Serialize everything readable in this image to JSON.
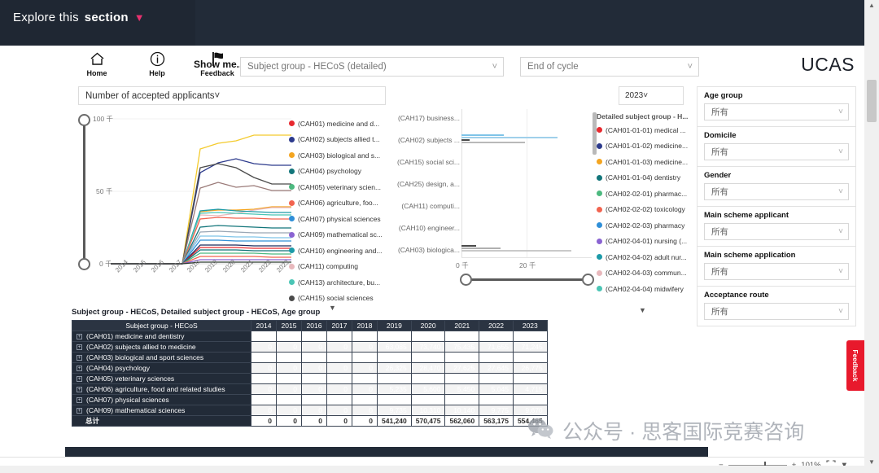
{
  "banner": {
    "explore_prefix": "Explore this",
    "explore_bold": "section",
    "chevron": "chevron-down"
  },
  "toolbar": {
    "items": [
      {
        "label": "Home",
        "icon": "home-icon"
      },
      {
        "label": "Help",
        "icon": "info-icon"
      },
      {
        "label": "Feedback",
        "icon": "flag-icon"
      }
    ],
    "show_me_label": "Show me...",
    "show_me_value": "Subject group - HECoS (detailed)",
    "cycle_value": "End of cycle",
    "brand": "UCAS"
  },
  "chart": {
    "measure_value": "Number of accepted applicants",
    "year_value": "2023",
    "y_ticks": [
      "100 千",
      "50 千",
      "0 千"
    ],
    "x_ticks": [
      "2014",
      "2015",
      "2016",
      "2017",
      "2018",
      "2019",
      "2020",
      "2021",
      "2022",
      "2023"
    ],
    "bar_axis_ticks": [
      "0 千",
      "20 千"
    ],
    "legend_left_title": "",
    "legend_right_title": "Detailed subject group - H...",
    "legend_left": [
      {
        "label": "(CAH01) medicine and d...",
        "color": "#e8292f"
      },
      {
        "label": "(CAH02) subjects allied t...",
        "color": "#2c3a8c"
      },
      {
        "label": "(CAH03) biological and s...",
        "color": "#f4a520"
      },
      {
        "label": "(CAH04) psychology",
        "color": "#12757a"
      },
      {
        "label": "(CAH05) veterinary scien...",
        "color": "#4cb97f"
      },
      {
        "label": "(CAH06) agriculture, foo...",
        "color": "#f2634f"
      },
      {
        "label": "(CAH07) physical sciences",
        "color": "#2f8fd8"
      },
      {
        "label": "(CAH09) mathematical sc...",
        "color": "#8a63d2"
      },
      {
        "label": "(CAH10) engineering and...",
        "color": "#1c9aa8"
      },
      {
        "label": "(CAH11) computing",
        "color": "#e8b8bc"
      },
      {
        "label": "(CAH13) architecture, bu...",
        "color": "#4bc5b5"
      },
      {
        "label": "(CAH15) social sciences",
        "color": "#4a4a4a"
      }
    ],
    "legend_right": [
      {
        "label": "(CAH01-01-01) medical ...",
        "color": "#e8292f"
      },
      {
        "label": "(CAH01-01-02) medicine...",
        "color": "#2c3a8c"
      },
      {
        "label": "(CAH01-01-03) medicine...",
        "color": "#f4a520"
      },
      {
        "label": "(CAH01-01-04) dentistry",
        "color": "#12757a"
      },
      {
        "label": "(CAH02-02-01) pharmac...",
        "color": "#4cb97f"
      },
      {
        "label": "(CAH02-02-02) toxicology",
        "color": "#f2634f"
      },
      {
        "label": "(CAH02-02-03) pharmacy",
        "color": "#2f8fd8"
      },
      {
        "label": "(CAH02-04-01) nursing (...",
        "color": "#8a63d2"
      },
      {
        "label": "(CAH02-04-02) adult nur...",
        "color": "#1c9aa8"
      },
      {
        "label": "(CAH02-04-03) commun...",
        "color": "#e8b8bc"
      },
      {
        "label": "(CAH02-04-04) midwifery",
        "color": "#4bc5b5"
      }
    ],
    "bar_categories": [
      "(CAH17) business...",
      "(CAH02) subjects ...",
      "(CAH15) social sci...",
      "(CAH25) design, a...",
      "(CAH11) computi...",
      "(CAH10) engineer...",
      "(CAH03) biologica..."
    ]
  },
  "chart_data": {
    "type": "line",
    "title": "Number of accepted applicants",
    "xlabel": "",
    "ylabel": "",
    "x": [
      2014,
      2015,
      2016,
      2017,
      2018,
      2019,
      2020,
      2021,
      2022,
      2023
    ],
    "ylim": [
      0,
      100000
    ],
    "y_tick_values": [
      0,
      50000,
      100000
    ],
    "y_tick_labels": [
      "0 千",
      "50 千",
      "100 千"
    ],
    "grid": true,
    "legend_position": "right",
    "series": [
      {
        "name": "(CAH17) business and management",
        "color": "#f4cb2e",
        "values": [
          0,
          0,
          0,
          0,
          0,
          79000,
          83000,
          85000,
          89000,
          89000
        ]
      },
      {
        "name": "(CAH02) subjects allied to medicine",
        "color": "#2c3a8c",
        "values": [
          0,
          0,
          0,
          0,
          0,
          63085,
          73740,
          75435,
          71655,
          71245
        ]
      },
      {
        "name": "(CAH15) social sciences",
        "color": "#4a4a4a",
        "values": [
          0,
          0,
          0,
          0,
          0,
          67000,
          69500,
          67000,
          62000,
          58500
        ]
      },
      {
        "name": "(CAH25) design and creative arts",
        "color": "#9a7a78",
        "values": [
          0,
          0,
          0,
          0,
          0,
          52500,
          56500,
          53000,
          54500,
          50500
        ]
      },
      {
        "name": "(CAH03) biological and sport sciences",
        "color": "#f4a520",
        "values": [
          0,
          0,
          0,
          0,
          0,
          33350,
          34345,
          34455,
          33615,
          32155
        ]
      },
      {
        "name": "(CAH11) computing",
        "color": "#e8b8bc",
        "values": [
          0,
          0,
          0,
          0,
          0,
          31000,
          30500,
          32000,
          33500,
          34500
        ]
      },
      {
        "name": "(CAH10) engineering and technology",
        "color": "#1c9aa8",
        "values": [
          0,
          0,
          0,
          0,
          0,
          32500,
          33500,
          32500,
          32000,
          31500
        ]
      },
      {
        "name": "(CAH13) architecture, building and planning",
        "color": "#4bc5b5",
        "values": [
          0,
          0,
          0,
          0,
          0,
          30500,
          31000,
          30500,
          30000,
          29500
        ]
      },
      {
        "name": "(CAH04) psychology",
        "color": "#12757a",
        "values": [
          0,
          0,
          0,
          0,
          0,
          26325,
          28470,
          27625,
          27645,
          26775
        ]
      },
      {
        "name": "(CAH06) agriculture, food and related studies",
        "color": "#f2634f",
        "values": [
          0,
          0,
          0,
          0,
          0,
          27000,
          28000,
          27500,
          27500,
          27000
        ]
      },
      {
        "name": "(CAH07) physical sciences",
        "color": "#2f8fd8",
        "values": [
          0,
          0,
          0,
          0,
          0,
          15285,
          15400,
          14830,
          14755,
          14560
        ]
      },
      {
        "name": "(CAH09) mathematical sciences",
        "color": "#8a63d2",
        "values": [
          0,
          0,
          0,
          0,
          0,
          9735,
          10310,
          10140,
          9775,
          9670
        ]
      },
      {
        "name": "(CAH01) medicine and dentistry",
        "color": "#e8292f",
        "values": [
          0,
          0,
          0,
          0,
          0,
          11905,
          13200,
          13520,
          12170,
          12870
        ]
      },
      {
        "name": "(CAH05) veterinary sciences",
        "color": "#4cb97f",
        "values": [
          0,
          0,
          0,
          0,
          0,
          2285,
          2665,
          2660,
          2370,
          2420
        ]
      }
    ]
  },
  "filters": [
    {
      "label": "Age group",
      "value": "所有"
    },
    {
      "label": "Domicile",
      "value": "所有"
    },
    {
      "label": "Gender",
      "value": "所有"
    },
    {
      "label": "Main scheme applicant",
      "value": "所有"
    },
    {
      "label": "Main scheme application",
      "value": "所有"
    },
    {
      "label": "Acceptance route",
      "value": "所有"
    }
  ],
  "table": {
    "caption": "Subject group - HECoS, Detailed subject group - HECoS, Age group",
    "columns": [
      "Subject group - HECoS",
      "2014",
      "2015",
      "2016",
      "2017",
      "2018",
      "2019",
      "2020",
      "2021",
      "2022",
      "2023"
    ],
    "rows": [
      {
        "name": "(CAH01) medicine and dentistry",
        "values": [
          "0",
          "0",
          "0",
          "0",
          "0",
          "11,905",
          "13,200",
          "13,520",
          "12,170",
          "12,870"
        ]
      },
      {
        "name": "(CAH02) subjects allied to medicine",
        "values": [
          "0",
          "0",
          "0",
          "0",
          "0",
          "63,085",
          "73,740",
          "75,435",
          "71,655",
          "71,245"
        ]
      },
      {
        "name": "(CAH03) biological and sport sciences",
        "values": [
          "0",
          "0",
          "0",
          "0",
          "0",
          "33,350",
          "34,345",
          "34,455",
          "33,615",
          "32,155"
        ]
      },
      {
        "name": "(CAH04) psychology",
        "values": [
          "0",
          "0",
          "0",
          "0",
          "0",
          "26,325",
          "28,470",
          "27,625",
          "27,645",
          "26,775"
        ]
      },
      {
        "name": "(CAH05) veterinary sciences",
        "values": [
          "0",
          "0",
          "0",
          "0",
          "0",
          "2,285",
          "2,665",
          "2,660",
          "2,370",
          "2,420"
        ]
      },
      {
        "name": "(CAH06) agriculture, food and related studies",
        "values": [
          "0",
          "0",
          "0",
          "0",
          "0",
          "5,235",
          "5,600",
          "5,450",
          "5,045",
          "4,715"
        ]
      },
      {
        "name": "(CAH07) physical sciences",
        "values": [
          "0",
          "0",
          "0",
          "0",
          "0",
          "15,285",
          "15,400",
          "14,830",
          "14,755",
          "14,560"
        ]
      },
      {
        "name": "(CAH09) mathematical sciences",
        "values": [
          "0",
          "0",
          "0",
          "0",
          "0",
          "9,735",
          "10,310",
          "10,140",
          "9,775",
          "9,670"
        ]
      }
    ],
    "total_label": "总计",
    "total_values": [
      "0",
      "0",
      "0",
      "0",
      "0",
      "541,240",
      "570,475",
      "562,060",
      "563,175",
      "554,465"
    ]
  },
  "watermark": {
    "text": "公众号 · 思客国际竞赛咨询",
    "icon": "wechat-icon"
  },
  "status": {
    "zoom": "101%"
  },
  "side_tab": {
    "label": "Feedback"
  }
}
